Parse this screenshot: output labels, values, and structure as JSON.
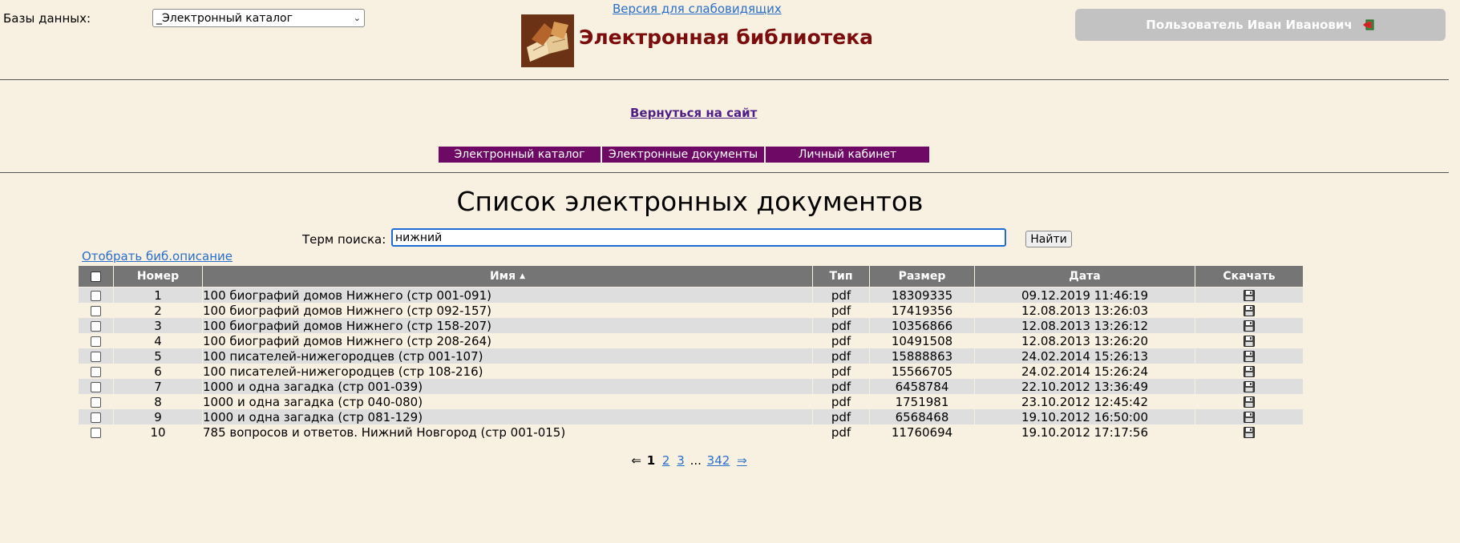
{
  "header": {
    "db_label": "Базы данных:",
    "db_selected": "_Электронный каталог",
    "low_vision_link": "Версия для слабовидящих",
    "library_title": "Электронная библиотека",
    "user_label": "Пользователь Иван Иванович"
  },
  "back_link": "Вернуться на сайт",
  "nav": {
    "items": [
      {
        "label": "Электронный каталог"
      },
      {
        "label": "Электронные документы"
      },
      {
        "label": "Личный кабинет"
      }
    ],
    "color": "#6e0a66"
  },
  "page_title": "Список электронных документов",
  "search": {
    "label": "Терм поиска:",
    "value": "нижний",
    "button": "Найти"
  },
  "show_bib_link": "Отобрать биб.описание",
  "table": {
    "columns": [
      "Номер",
      "Имя",
      "Тип",
      "Размер",
      "Дата",
      "Скачать"
    ],
    "sorted_by": "Имя",
    "rows": [
      {
        "num": "1",
        "name": "100 биографий домов Нижнего (стр 001-091)",
        "type": "pdf",
        "size": "18309335",
        "date": "09.12.2019 11:46:19"
      },
      {
        "num": "2",
        "name": "100 биографий домов Нижнего (стр 092-157)",
        "type": "pdf",
        "size": "17419356",
        "date": "12.08.2013 13:26:03"
      },
      {
        "num": "3",
        "name": "100 биографий домов Нижнего (стр 158-207)",
        "type": "pdf",
        "size": "10356866",
        "date": "12.08.2013 13:26:12"
      },
      {
        "num": "4",
        "name": "100 биографий домов Нижнего (стр 208-264)",
        "type": "pdf",
        "size": "10491508",
        "date": "12.08.2013 13:26:20"
      },
      {
        "num": "5",
        "name": "100 писателей-нижегородцев (стр 001-107)",
        "type": "pdf",
        "size": "15888863",
        "date": "24.02.2014 15:26:13"
      },
      {
        "num": "6",
        "name": "100 писателей-нижегородцев (стр 108-216)",
        "type": "pdf",
        "size": "15566705",
        "date": "24.02.2014 15:26:24"
      },
      {
        "num": "7",
        "name": "1000 и одна загадка (стр 001-039)",
        "type": "pdf",
        "size": "6458784",
        "date": "22.10.2012 13:36:49"
      },
      {
        "num": "8",
        "name": "1000 и одна загадка (стр 040-080)",
        "type": "pdf",
        "size": "1751981",
        "date": "23.10.2012 12:45:42"
      },
      {
        "num": "9",
        "name": "1000 и одна загадка (стр 081-129)",
        "type": "pdf",
        "size": "6568468",
        "date": "19.10.2012 16:50:00"
      },
      {
        "num": "10",
        "name": "785 вопросов и ответов. Нижний Новгород (стр 001-015)",
        "type": "pdf",
        "size": "11760694",
        "date": "19.10.2012 17:17:56"
      }
    ]
  },
  "pager": {
    "prev": "⇐",
    "current": "1",
    "pages": [
      "2",
      "3"
    ],
    "ellipsis": "...",
    "last": "342",
    "next": "⇒"
  }
}
